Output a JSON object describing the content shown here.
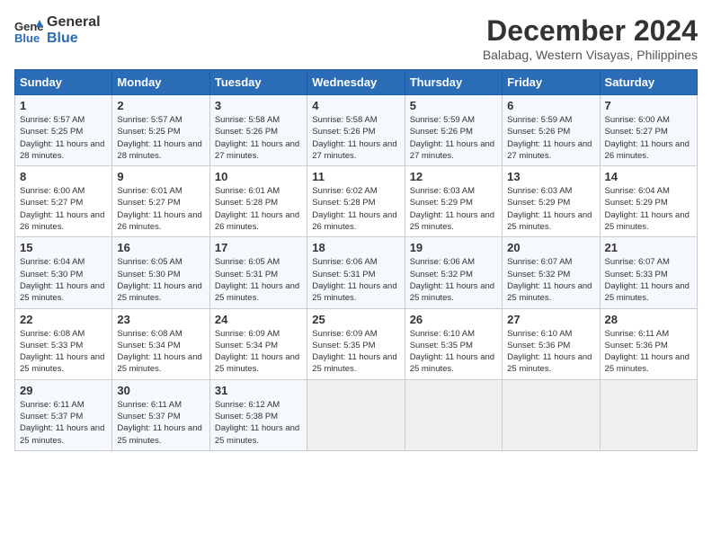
{
  "header": {
    "logo_line1": "General",
    "logo_line2": "Blue",
    "month": "December 2024",
    "location": "Balabag, Western Visayas, Philippines"
  },
  "weekdays": [
    "Sunday",
    "Monday",
    "Tuesday",
    "Wednesday",
    "Thursday",
    "Friday",
    "Saturday"
  ],
  "weeks": [
    [
      {
        "day": "1",
        "sunrise": "5:57 AM",
        "sunset": "5:25 PM",
        "daylight": "11 hours and 28 minutes."
      },
      {
        "day": "2",
        "sunrise": "5:57 AM",
        "sunset": "5:25 PM",
        "daylight": "11 hours and 28 minutes."
      },
      {
        "day": "3",
        "sunrise": "5:58 AM",
        "sunset": "5:26 PM",
        "daylight": "11 hours and 27 minutes."
      },
      {
        "day": "4",
        "sunrise": "5:58 AM",
        "sunset": "5:26 PM",
        "daylight": "11 hours and 27 minutes."
      },
      {
        "day": "5",
        "sunrise": "5:59 AM",
        "sunset": "5:26 PM",
        "daylight": "11 hours and 27 minutes."
      },
      {
        "day": "6",
        "sunrise": "5:59 AM",
        "sunset": "5:26 PM",
        "daylight": "11 hours and 27 minutes."
      },
      {
        "day": "7",
        "sunrise": "6:00 AM",
        "sunset": "5:27 PM",
        "daylight": "11 hours and 26 minutes."
      }
    ],
    [
      {
        "day": "8",
        "sunrise": "6:00 AM",
        "sunset": "5:27 PM",
        "daylight": "11 hours and 26 minutes."
      },
      {
        "day": "9",
        "sunrise": "6:01 AM",
        "sunset": "5:27 PM",
        "daylight": "11 hours and 26 minutes."
      },
      {
        "day": "10",
        "sunrise": "6:01 AM",
        "sunset": "5:28 PM",
        "daylight": "11 hours and 26 minutes."
      },
      {
        "day": "11",
        "sunrise": "6:02 AM",
        "sunset": "5:28 PM",
        "daylight": "11 hours and 26 minutes."
      },
      {
        "day": "12",
        "sunrise": "6:03 AM",
        "sunset": "5:29 PM",
        "daylight": "11 hours and 25 minutes."
      },
      {
        "day": "13",
        "sunrise": "6:03 AM",
        "sunset": "5:29 PM",
        "daylight": "11 hours and 25 minutes."
      },
      {
        "day": "14",
        "sunrise": "6:04 AM",
        "sunset": "5:29 PM",
        "daylight": "11 hours and 25 minutes."
      }
    ],
    [
      {
        "day": "15",
        "sunrise": "6:04 AM",
        "sunset": "5:30 PM",
        "daylight": "11 hours and 25 minutes."
      },
      {
        "day": "16",
        "sunrise": "6:05 AM",
        "sunset": "5:30 PM",
        "daylight": "11 hours and 25 minutes."
      },
      {
        "day": "17",
        "sunrise": "6:05 AM",
        "sunset": "5:31 PM",
        "daylight": "11 hours and 25 minutes."
      },
      {
        "day": "18",
        "sunrise": "6:06 AM",
        "sunset": "5:31 PM",
        "daylight": "11 hours and 25 minutes."
      },
      {
        "day": "19",
        "sunrise": "6:06 AM",
        "sunset": "5:32 PM",
        "daylight": "11 hours and 25 minutes."
      },
      {
        "day": "20",
        "sunrise": "6:07 AM",
        "sunset": "5:32 PM",
        "daylight": "11 hours and 25 minutes."
      },
      {
        "day": "21",
        "sunrise": "6:07 AM",
        "sunset": "5:33 PM",
        "daylight": "11 hours and 25 minutes."
      }
    ],
    [
      {
        "day": "22",
        "sunrise": "6:08 AM",
        "sunset": "5:33 PM",
        "daylight": "11 hours and 25 minutes."
      },
      {
        "day": "23",
        "sunrise": "6:08 AM",
        "sunset": "5:34 PM",
        "daylight": "11 hours and 25 minutes."
      },
      {
        "day": "24",
        "sunrise": "6:09 AM",
        "sunset": "5:34 PM",
        "daylight": "11 hours and 25 minutes."
      },
      {
        "day": "25",
        "sunrise": "6:09 AM",
        "sunset": "5:35 PM",
        "daylight": "11 hours and 25 minutes."
      },
      {
        "day": "26",
        "sunrise": "6:10 AM",
        "sunset": "5:35 PM",
        "daylight": "11 hours and 25 minutes."
      },
      {
        "day": "27",
        "sunrise": "6:10 AM",
        "sunset": "5:36 PM",
        "daylight": "11 hours and 25 minutes."
      },
      {
        "day": "28",
        "sunrise": "6:11 AM",
        "sunset": "5:36 PM",
        "daylight": "11 hours and 25 minutes."
      }
    ],
    [
      {
        "day": "29",
        "sunrise": "6:11 AM",
        "sunset": "5:37 PM",
        "daylight": "11 hours and 25 minutes."
      },
      {
        "day": "30",
        "sunrise": "6:11 AM",
        "sunset": "5:37 PM",
        "daylight": "11 hours and 25 minutes."
      },
      {
        "day": "31",
        "sunrise": "6:12 AM",
        "sunset": "5:38 PM",
        "daylight": "11 hours and 25 minutes."
      },
      null,
      null,
      null,
      null
    ]
  ]
}
